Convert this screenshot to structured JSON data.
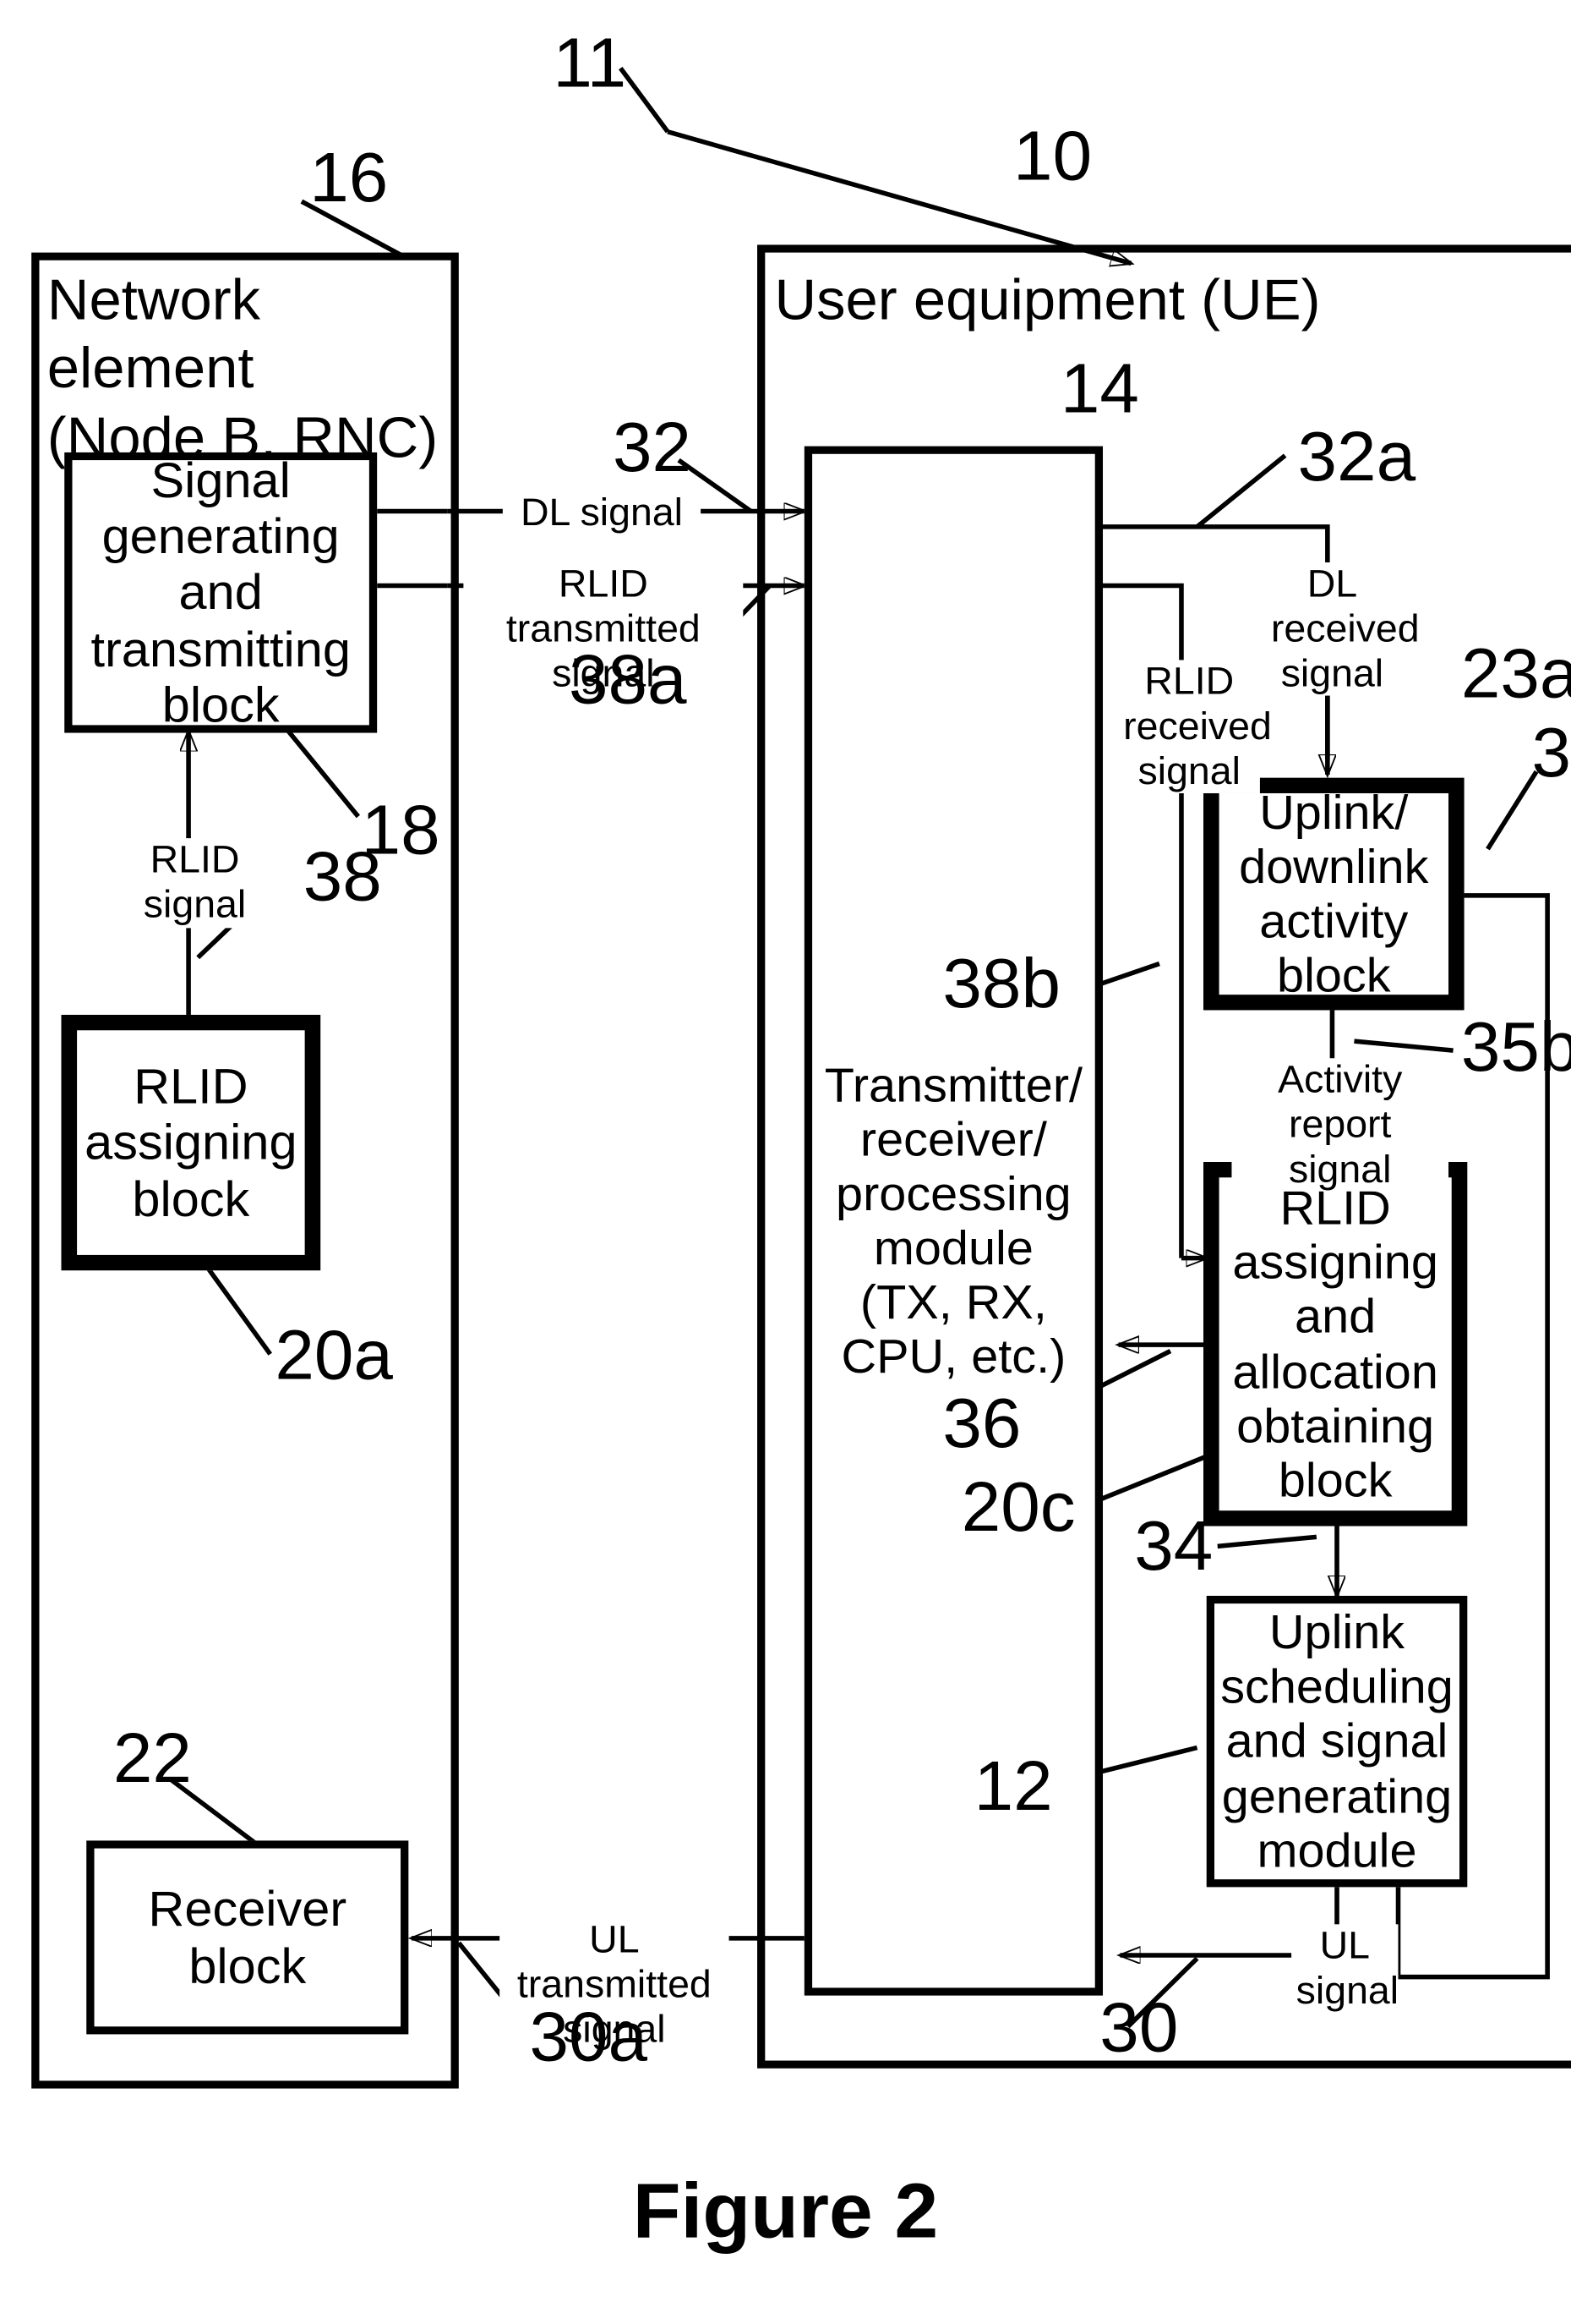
{
  "figure": {
    "caption": "Figure 2",
    "system_ref": "11"
  },
  "network_element": {
    "ref": "16",
    "title": "Network element\n(Node B, RNC)",
    "blocks": [
      {
        "ref": "18",
        "label": "Signal\ngenerating\nand\ntransmitting\nblock"
      },
      {
        "ref": "20a",
        "label": "RLID\nassigning\nblock"
      },
      {
        "ref": "22",
        "label": "Receiver\nblock"
      }
    ],
    "signals": [
      {
        "ref": "38",
        "label": "RLID\nsignal"
      }
    ]
  },
  "user_equipment": {
    "ref": "10",
    "title": "User equipment (UE)",
    "blocks": [
      {
        "ref": "14",
        "label": "Transmitter/\nreceiver/\nprocessing\nmodule\n(TX, RX,\nCPU, etc.)"
      },
      {
        "ref": "23a",
        "label": "Uplink/\ndownlink\nactivity\nblock"
      },
      {
        "ref": "20c",
        "label": "RLID\nassigning\nand\nallocation\nobtaining\nblock"
      },
      {
        "ref": "12",
        "label": "Uplink\nscheduling\nand signal\ngenerating\nmodule"
      }
    ],
    "signals": [
      {
        "ref": "32a",
        "label": "DL\nreceived\nsignal"
      },
      {
        "ref": "38b",
        "label": "RLID\nreceived\nsignal"
      },
      {
        "ref": "35b",
        "label": "Activity report\nsignal"
      },
      {
        "ref": "36",
        "label": ""
      },
      {
        "ref": "34",
        "label": ""
      },
      {
        "ref": "30",
        "label": "UL\nsignal"
      }
    ]
  },
  "interlinks": [
    {
      "ref": "32",
      "label": "DL signal"
    },
    {
      "ref": "38a",
      "label": "RLID transmitted\nsignal"
    },
    {
      "ref": "30a",
      "label": "UL transmitted\nsignal"
    }
  ],
  "refs": {
    "r10": "10",
    "r11": "11",
    "r12": "12",
    "r14": "14",
    "r16": "16",
    "r18": "18",
    "r20a": "20a",
    "r20c": "20c",
    "r22": "22",
    "r23a": "23a",
    "r30": "30",
    "r30_right": "30",
    "r30a": "30a",
    "r32": "32",
    "r32a": "32a",
    "r34": "34",
    "r35b": "35b",
    "r36": "36",
    "r38": "38",
    "r38a": "38a",
    "r38b": "38b"
  },
  "colors": {
    "ink": "#000000",
    "paper": "#ffffff"
  }
}
